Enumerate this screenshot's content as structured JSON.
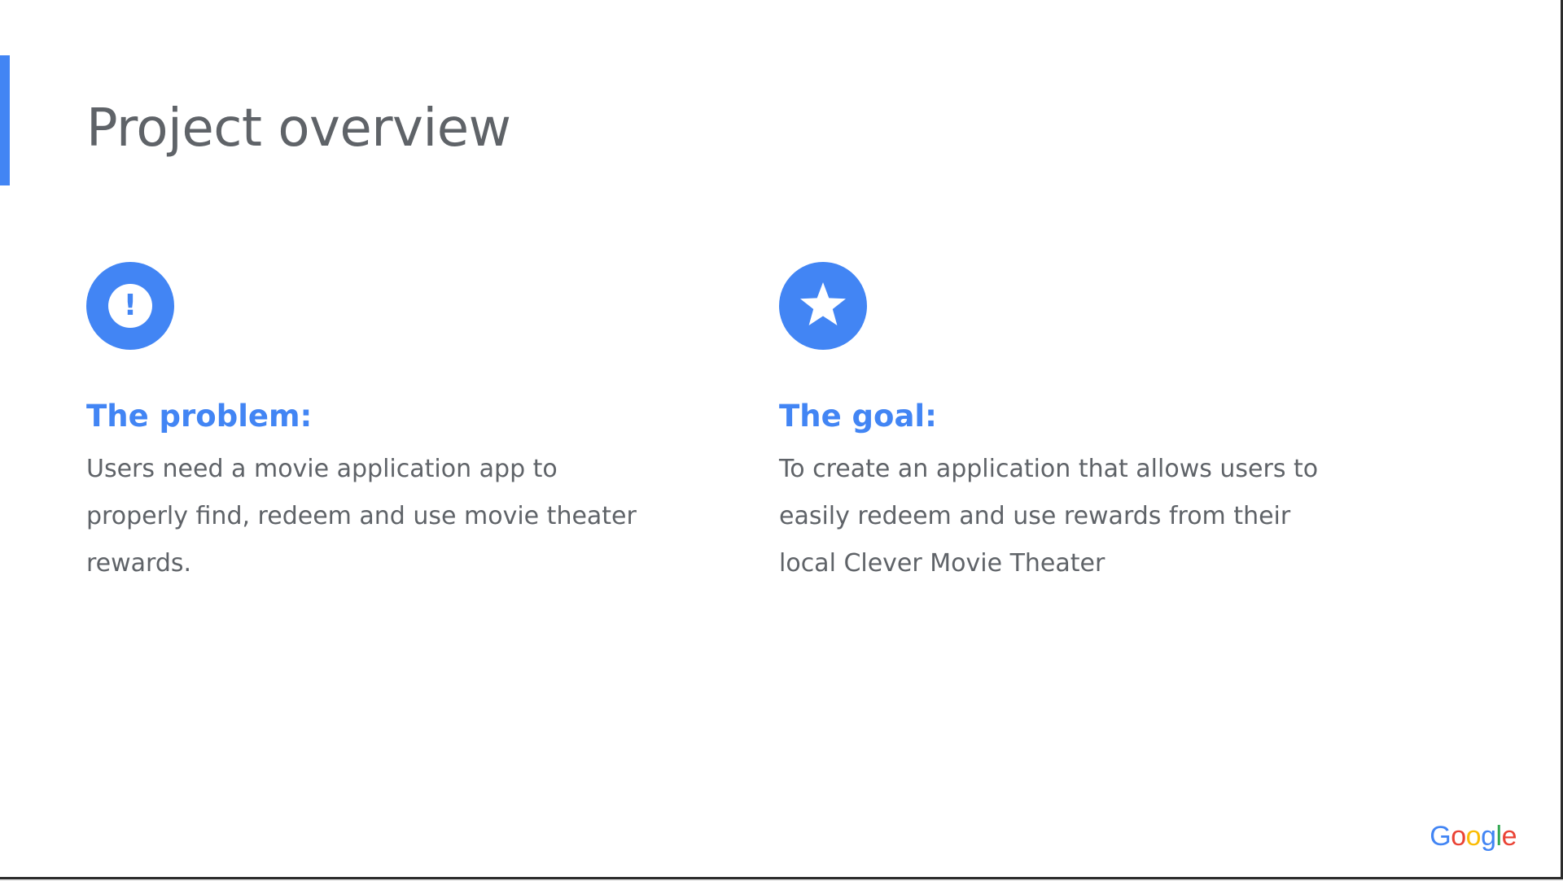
{
  "slide": {
    "title": "Project overview",
    "accent_color": "#4285f4",
    "text_color": "#5f6368"
  },
  "problem": {
    "icon": "exclamation-circle-icon",
    "icon_glyph": "!",
    "heading": "The problem:",
    "body": "Users need a movie application app to properly find, redeem and use movie theater rewards."
  },
  "goal": {
    "icon": "star-circle-icon",
    "heading": "The goal:",
    "body": "To create an application that allows users to easily redeem and use rewards from their local Clever Movie Theater"
  },
  "logo": {
    "text": "Google",
    "letters": [
      "G",
      "o",
      "o",
      "g",
      "l",
      "e"
    ],
    "colors": [
      "#4285f4",
      "#ea4335",
      "#fbbc05",
      "#4285f4",
      "#34a853",
      "#ea4335"
    ]
  }
}
